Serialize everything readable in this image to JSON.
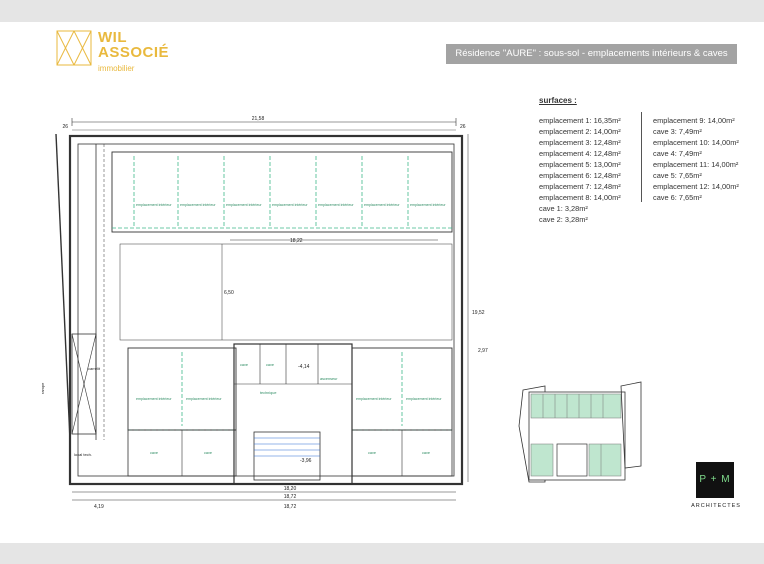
{
  "logo": {
    "line1": "WIL",
    "line2": "ASSOCIÉ",
    "sub": "immobilier"
  },
  "title": "Résidence \"AURE\" : sous-sol - emplacements intérieurs & caves",
  "surfaces": {
    "heading": "surfaces :",
    "col1": [
      "emplacement 1: 16,35m²",
      "emplacement 2: 14,00m²",
      "emplacement 3: 12,48m²",
      "emplacement 4: 12,48m²",
      "emplacement 5: 13,00m²",
      "emplacement 6: 12,48m²",
      "emplacement 7: 12,48m²",
      "emplacement 8: 14,00m²",
      "cave 1: 3,28m²",
      "cave 2: 3,28m²"
    ],
    "col2": [
      "emplacement 9: 14,00m²",
      "cave 3: 7,49m²",
      "emplacement 10: 14,00m²",
      "cave 4: 7,49m²",
      "emplacement 11: 14,00m²",
      "cave 5: 7,65m²",
      "emplacement 12: 14,00m²",
      "cave 6: 7,65m²"
    ]
  },
  "plan": {
    "dim_top_total": "21,58",
    "dim_top_left": "26",
    "dim_top_right": "26",
    "dim_bottom_1": "18,20",
    "dim_bottom_2": "18,72",
    "dim_bottom_3": "4,19",
    "dim_bottom_4": "18,72",
    "dim_right": "19,52",
    "dim_right_small": "2,97",
    "dim_mid": "18,22",
    "dim_inner": "6,50",
    "dim_stair": "-3,96",
    "dim_level": "-4,14",
    "label_space": "emplacement intérieur",
    "label_cave": "cave",
    "label_ramp": "rampe",
    "label_tech": "technique",
    "label_local": "local tech.",
    "label_ascenseur": "ascenseur",
    "label_carrelit": "carrelit"
  },
  "brand": {
    "mark": "P + M",
    "sub": "ARCHITECTES"
  },
  "colors": {
    "accent": "#e9b93e",
    "green": "#3fb98a",
    "keyplan_green": "#bfe6cf",
    "title_bg": "#a3a3a3"
  }
}
